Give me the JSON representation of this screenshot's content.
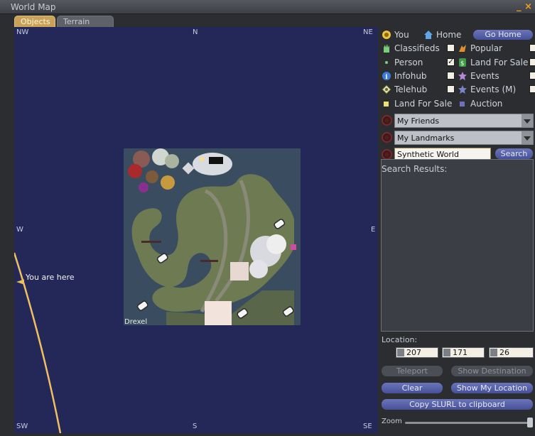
{
  "window": {
    "title": "World Map",
    "controls": "_ ×"
  },
  "tabs": [
    {
      "label": "Objects"
    },
    {
      "label": "Terrain"
    }
  ],
  "map": {
    "compass": {
      "nw": "NW",
      "n": "N",
      "ne": "NE",
      "w": "W",
      "e": "E",
      "sw": "SW",
      "s": "S",
      "se": "SE"
    },
    "region_name": "Drexel",
    "you_are_here": "You are here"
  },
  "legend": {
    "you": "You",
    "home": "Home",
    "go_home": "Go Home",
    "classifieds": "Classifieds",
    "popular": "Popular",
    "person": "Person",
    "land_for_sale_icon": "Land For Sale",
    "infohub": "Infohub",
    "events": "Events",
    "telehub": "Telehub",
    "events_mature": "Events (M)",
    "land_for_sale": "Land For Sale",
    "auction": "Auction"
  },
  "dropdowns": {
    "friends": "My Friends",
    "landmarks": "My Landmarks"
  },
  "search": {
    "value": "Synthetic World",
    "button": "Search",
    "results_label": "Search Results:"
  },
  "location": {
    "label": "Location:",
    "x": "207",
    "y": "171",
    "z": "26"
  },
  "buttons": {
    "teleport": "Teleport",
    "show_destination": "Show Destination",
    "clear": "Clear",
    "show_my_location": "Show My Location",
    "copy_slurl": "Copy SLURL to clipboard"
  },
  "zoom": {
    "label": "Zoom"
  },
  "colors": {
    "map_bg": "#232858",
    "accent": "#f0a01e",
    "button": "#525ca6"
  }
}
